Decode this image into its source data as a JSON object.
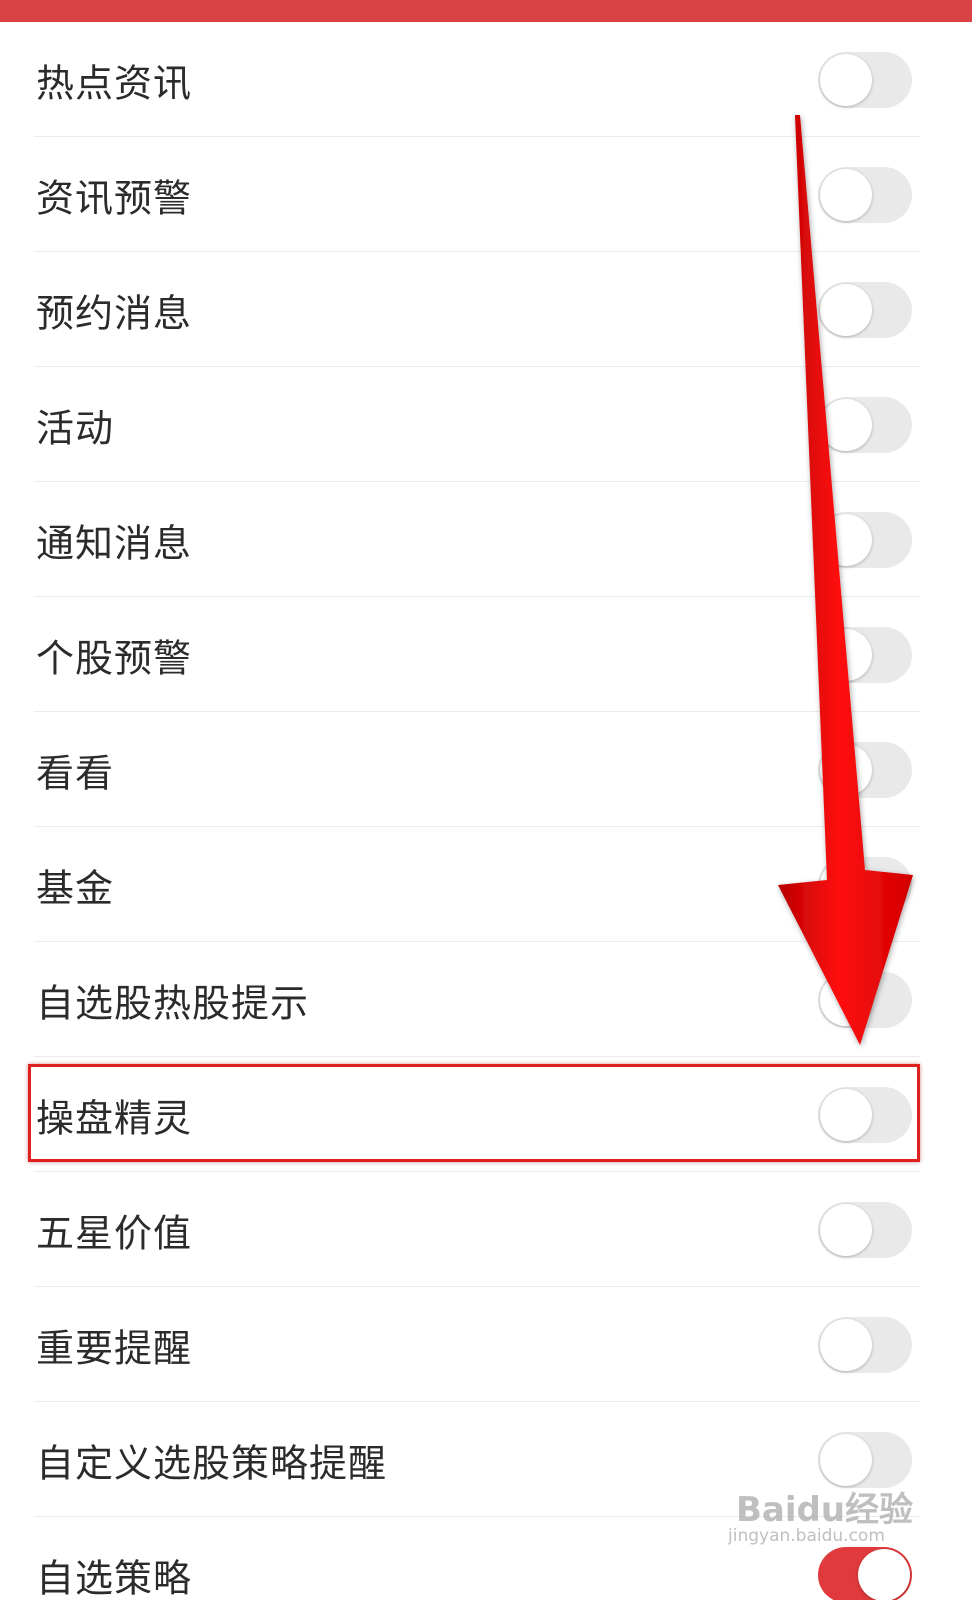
{
  "colors": {
    "accent": "#d94345",
    "toggle_on": "#e03a3c",
    "toggle_off": "#e9e9e9",
    "annotation_red": "#e0201f"
  },
  "settings": [
    {
      "label": "热点资讯",
      "enabled": false
    },
    {
      "label": "资讯预警",
      "enabled": false
    },
    {
      "label": "预约消息",
      "enabled": false
    },
    {
      "label": "活动",
      "enabled": false
    },
    {
      "label": "通知消息",
      "enabled": false
    },
    {
      "label": "个股预警",
      "enabled": false
    },
    {
      "label": "看看",
      "enabled": false
    },
    {
      "label": "基金",
      "enabled": false
    },
    {
      "label": "自选股热股提示",
      "enabled": false
    },
    {
      "label": "操盘精灵",
      "enabled": false
    },
    {
      "label": "五星价值",
      "enabled": false
    },
    {
      "label": "重要提醒",
      "enabled": false
    },
    {
      "label": "自定义选股策略提醒",
      "enabled": false
    },
    {
      "label": "自选策略",
      "enabled": true
    }
  ],
  "annotation": {
    "highlighted_item": "操盘精灵",
    "arrow": "down-arrow-icon"
  },
  "watermark": {
    "logo": "Baidu经验",
    "url": "jingyan.baidu.com"
  }
}
